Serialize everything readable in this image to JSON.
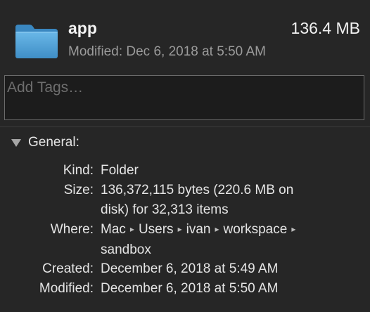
{
  "header": {
    "file_name": "app",
    "file_size": "136.4 MB",
    "modified_summary": "Modified: Dec 6, 2018 at 5:50 AM",
    "icon": "folder-icon"
  },
  "tags": {
    "placeholder": "Add Tags…",
    "value": ""
  },
  "general": {
    "title": "General:",
    "expanded": true,
    "disclosure_icon": "disclosure-triangle-down-icon",
    "kind": {
      "label": "Kind:",
      "value": "Folder"
    },
    "size": {
      "label": "Size:",
      "line1": "136,372,115 bytes (220.6 MB on",
      "line2": "disk) for 32,313 items"
    },
    "where": {
      "label": "Where:",
      "path": [
        "Mac",
        "Users",
        "ivan",
        "workspace"
      ],
      "last": "sandbox",
      "separator": "▸"
    },
    "created": {
      "label": "Created:",
      "value": "December 6, 2018 at 5:49 AM"
    },
    "modified": {
      "label": "Modified:",
      "value": "December 6, 2018 at 5:50 AM"
    }
  },
  "colors": {
    "background": "#262626",
    "folder": "#4fa0d8",
    "secondary_text": "#9b9b9b"
  }
}
